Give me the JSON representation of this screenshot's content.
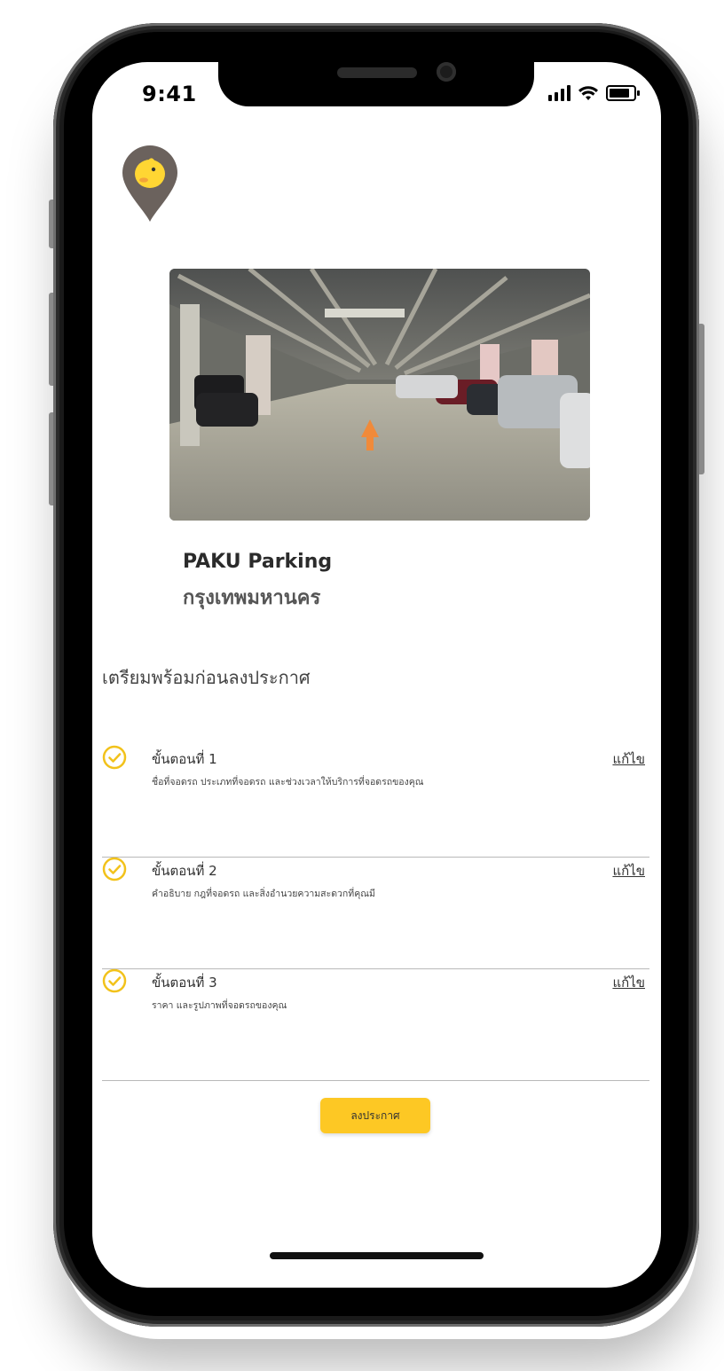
{
  "status_bar": {
    "time": "9:41"
  },
  "listing": {
    "name": "PAKU Parking",
    "city": "กรุงเทพมหานคร"
  },
  "section": {
    "title": "เตรียมพร้อมก่อนลงประกาศ"
  },
  "steps": [
    {
      "title": "ขั้นตอนที่ 1",
      "description": "ชื่อที่จอดรถ ประเภทที่จอดรถ และช่วงเวลาให้บริการที่จอดรถของคุณ",
      "edit_label": "แก้ไข"
    },
    {
      "title": "ขั้นตอนที่ 2",
      "description": "คำอธิบาย กฎที่จอดรถ และสิ่งอำนวยความสะดวกที่คุณมี",
      "edit_label": "แก้ไข"
    },
    {
      "title": "ขั้นตอนที่ 3",
      "description": "ราคา และรูปภาพที่จอดรถของคุณ",
      "edit_label": "แก้ไข"
    }
  ],
  "publish_button": {
    "label": "ลงประกาศ"
  },
  "colors": {
    "accent": "#fdc824",
    "logo_pin": "#6b625d",
    "check": "#f2c21b",
    "text_dark": "#2b2b2b",
    "divider": "#b9b9b9"
  },
  "icons": {
    "logo": "chick-location-pin-icon",
    "step_status": "check-circle-icon"
  }
}
